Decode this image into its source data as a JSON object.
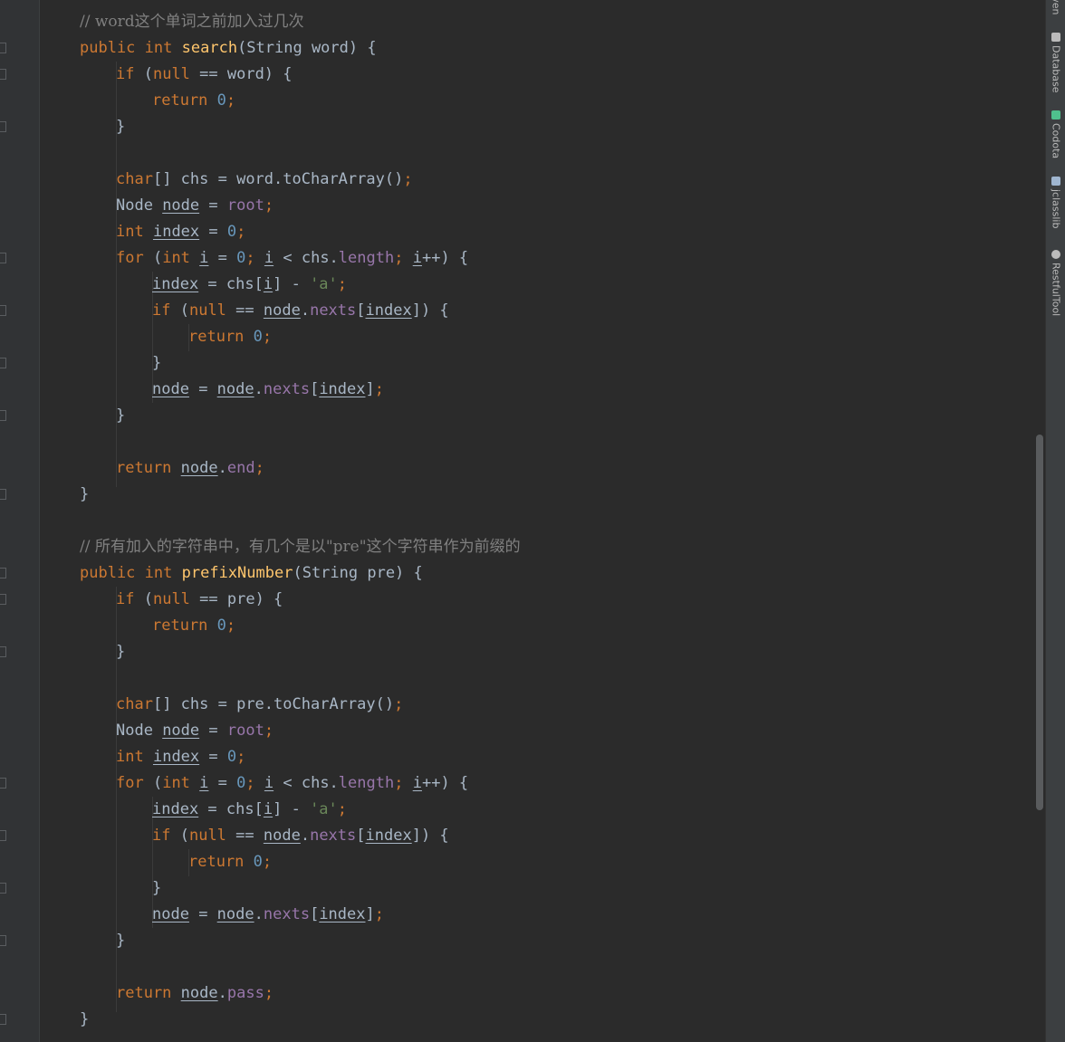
{
  "code": {
    "l1": "// word这个单词之前加入过几次",
    "k_public": "public",
    "k_int": "int",
    "k_if": "if",
    "k_null": "null",
    "k_return": "return",
    "k_char": "char",
    "k_for": "for",
    "num_zero": "0",
    "fn_search": "search",
    "fn_prefix": "prefixNumber",
    "param_word_sig": "(String word) {",
    "param_pre_sig": "(String pre) {",
    "cond_word": " == word) {",
    "cond_pre": " == pre) {",
    "open_paren": " (",
    "semi": ";",
    "brace_close": "}",
    "arr_brackets": "[] chs = ",
    "word_var": "word",
    "pre_var": "pre",
    "to_char_array": ".toCharArray()",
    "node_type": "Node ",
    "node_var": "node",
    "assign": " = ",
    "root_field": "root",
    "index_var": "index",
    "i_var": "i",
    "lt_chs": " < chs.",
    "length_field": "length",
    "inc": "++",
    "paren_brace": ") {",
    "chs_open": "chs[",
    "close_minus": "] - ",
    "char_a": "'a'",
    "eq_eq": " == ",
    "dot": ".",
    "nexts_field": "nexts",
    "lbracket": "[",
    "rbracket_paren": "]) {",
    "rbracket": "]",
    "end_field": "end",
    "pass_field": "pass",
    "comment2": "// 所有加入的字符串中，有几个是以\"pre\"这个字符串作为前缀的"
  },
  "toolbar": {
    "maven": "Maven",
    "database": "Database",
    "codota": "Codota",
    "jclasslib": "jclasslib",
    "restful": "RestfulTool"
  },
  "colors": {
    "background": "#2b2b2b",
    "keyword": "#cc7832",
    "number": "#6897bb",
    "method": "#ffc66d",
    "field": "#9876aa",
    "string": "#6a8759",
    "comment": "#808080",
    "text": "#a9b7c6"
  }
}
